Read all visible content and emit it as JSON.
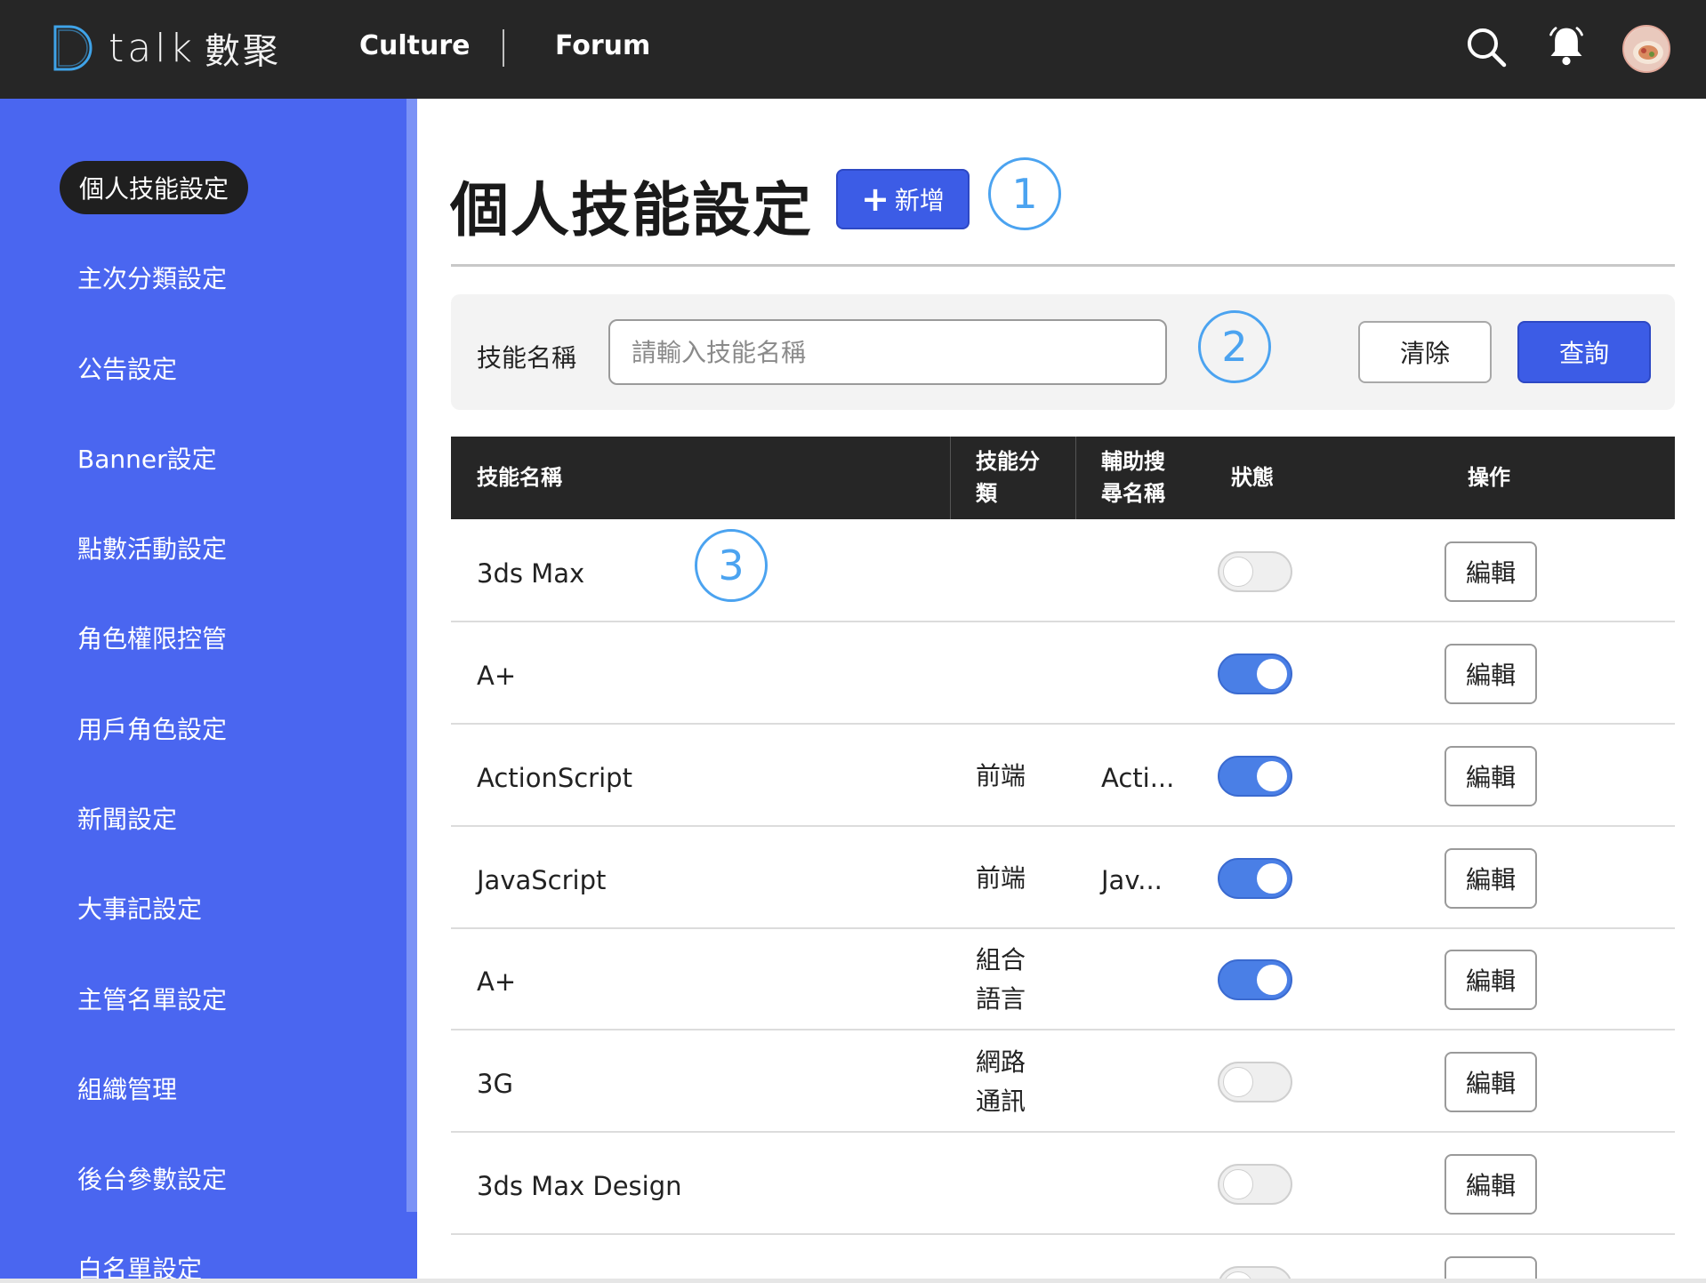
{
  "header": {
    "logo_text": "talk",
    "logo_cn": "數聚",
    "nav": [
      {
        "label": "Culture"
      },
      {
        "label": "Forum"
      }
    ]
  },
  "sidebar": {
    "items": [
      {
        "label": "個人技能設定",
        "active": true
      },
      {
        "label": "主次分類設定"
      },
      {
        "label": "公告設定"
      },
      {
        "label": "Banner設定"
      },
      {
        "label": "點數活動設定"
      },
      {
        "label": "角色權限控管"
      },
      {
        "label": "用戶角色設定"
      },
      {
        "label": "新聞設定"
      },
      {
        "label": "大事記設定"
      },
      {
        "label": "主管名單設定"
      },
      {
        "label": "組織管理"
      },
      {
        "label": "後台參數設定"
      },
      {
        "label": "白名單設定"
      }
    ]
  },
  "main": {
    "title": "個人技能設定",
    "add_label": "新增",
    "annotations": [
      "1",
      "2",
      "3"
    ]
  },
  "filter": {
    "label": "技能名稱",
    "placeholder": "請輸入技能名稱",
    "value": "",
    "clear_label": "清除",
    "query_label": "查詢"
  },
  "table": {
    "headers": {
      "name": "技能名稱",
      "category_line1": "技能分",
      "category_line2": "類",
      "alias_line1": "輔助搜",
      "alias_line2": "尋名稱",
      "status": "狀態",
      "actions": "操作"
    },
    "edit_label": "編輯",
    "rows": [
      {
        "name": "3ds Max",
        "category_line1": "",
        "category_line2": "",
        "alias": "",
        "enabled": false
      },
      {
        "name": "A+",
        "category_line1": "",
        "category_line2": "",
        "alias": "",
        "enabled": true
      },
      {
        "name": "ActionScript",
        "category_line1": "前端",
        "category_line2": "",
        "alias": "Acti...",
        "enabled": true
      },
      {
        "name": "JavaScript",
        "category_line1": "前端",
        "category_line2": "",
        "alias": "Jav...",
        "enabled": true
      },
      {
        "name": "A+",
        "category_line1": "組合",
        "category_line2": "語言",
        "alias": "",
        "enabled": true
      },
      {
        "name": "3G",
        "category_line1": "網路",
        "category_line2": "通訊",
        "alias": "",
        "enabled": false
      },
      {
        "name": "3ds Max Design",
        "category_line1": "",
        "category_line2": "",
        "alias": "",
        "enabled": false
      }
    ]
  },
  "colors": {
    "topbar": "#262626",
    "sidebar": "#4a66f0",
    "primary_button": "#3c5ce6",
    "toggle_on": "#4a7fe6",
    "annotation": "#4ba3f0"
  }
}
